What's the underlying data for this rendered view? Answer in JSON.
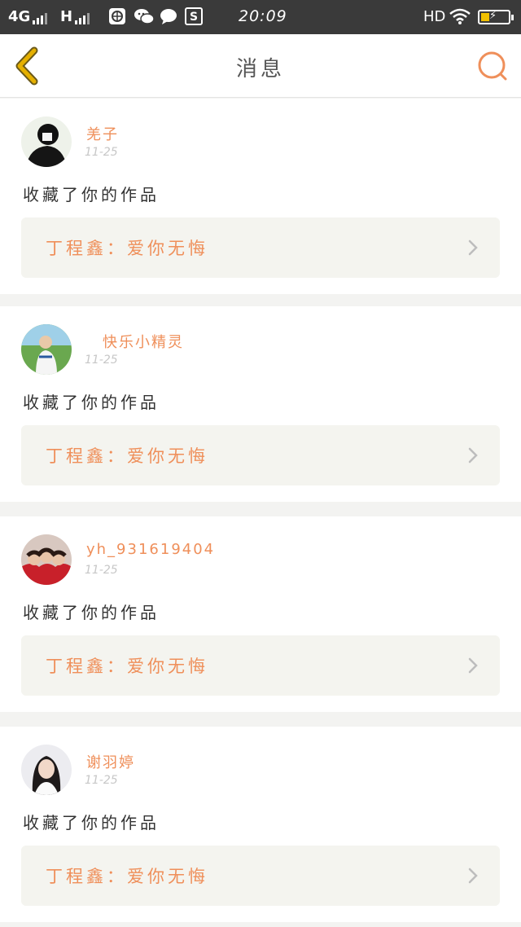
{
  "status_bar": {
    "network_1": "4G",
    "network_2": "H",
    "time": "20:09",
    "hd": "HD",
    "icons": [
      "globe-icon",
      "wechat-icon",
      "chat-bubble-icon",
      "s-app-icon",
      "wifi-icon",
      "battery-charging-icon"
    ]
  },
  "header": {
    "title": "消息",
    "back_icon": "chevron-left-icon",
    "search_icon": "search-icon"
  },
  "colors": {
    "accent": "#ef8f5a",
    "back_arrow": "#e5b000",
    "status_bar_bg": "#3a3a3a",
    "card_link_bg": "#f4f4ef"
  },
  "messages": [
    {
      "username": "羌子",
      "date": "11-25",
      "action": "收藏了你的作品",
      "work": "丁程鑫：爱你无悔"
    },
    {
      "username": "快乐小精灵",
      "date": "11-25",
      "action": "收藏了你的作品",
      "work": "丁程鑫：爱你无悔"
    },
    {
      "username": "yh_931619404",
      "date": "11-25",
      "action": "收藏了你的作品",
      "work": "丁程鑫：爱你无悔"
    },
    {
      "username": "谢羽婷",
      "date": "11-25",
      "action": "收藏了你的作品",
      "work": "丁程鑫：爱你无悔"
    }
  ]
}
